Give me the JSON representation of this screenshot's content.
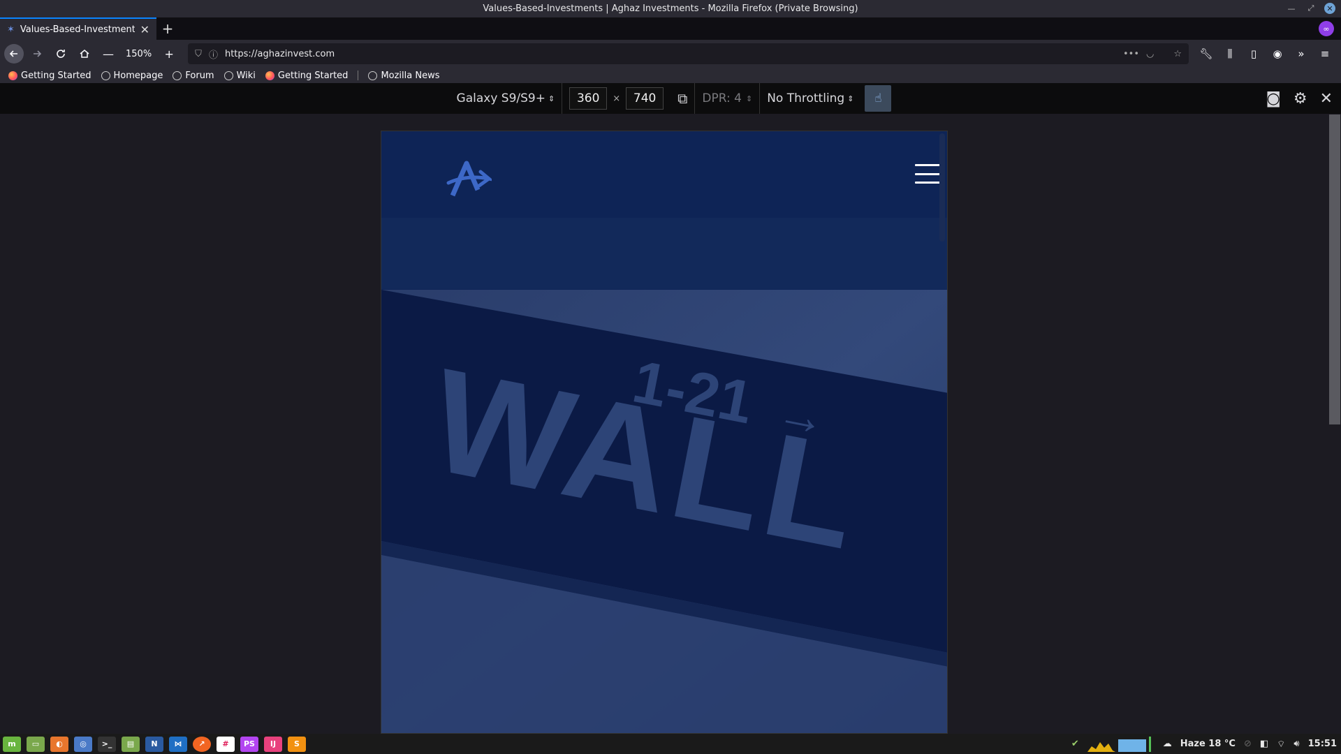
{
  "window": {
    "title": "Values-Based-Investments | Aghaz Investments - Mozilla Firefox (Private Browsing)"
  },
  "tabs": [
    {
      "title": "Values-Based-Investments",
      "active": true
    }
  ],
  "navbar": {
    "zoom": "150%",
    "url": "https://aghazinvest.com"
  },
  "bookmarks": [
    {
      "label": "Getting Started",
      "icon": "firefox-icon"
    },
    {
      "label": "Homepage",
      "icon": "globe-icon"
    },
    {
      "label": "Forum",
      "icon": "globe-icon"
    },
    {
      "label": "Wiki",
      "icon": "globe-icon"
    },
    {
      "label": "Getting Started",
      "icon": "firefox-icon"
    },
    {
      "label": "Mozilla News",
      "icon": "globe-icon"
    }
  ],
  "rdm": {
    "device": "Galaxy S9/S9+",
    "width": "360",
    "height": "740",
    "times": "×",
    "dpr": "DPR: 4",
    "throttling": "No Throttling"
  },
  "page": {
    "hero_text": [
      "1-21",
      "WALL"
    ]
  },
  "taskbar": {
    "weather": "Haze 18 °C",
    "clock": "15:51"
  },
  "colors": {
    "accent": "#0a84ff",
    "page_navy": "#0e2456",
    "private": "#8f3ee8"
  }
}
